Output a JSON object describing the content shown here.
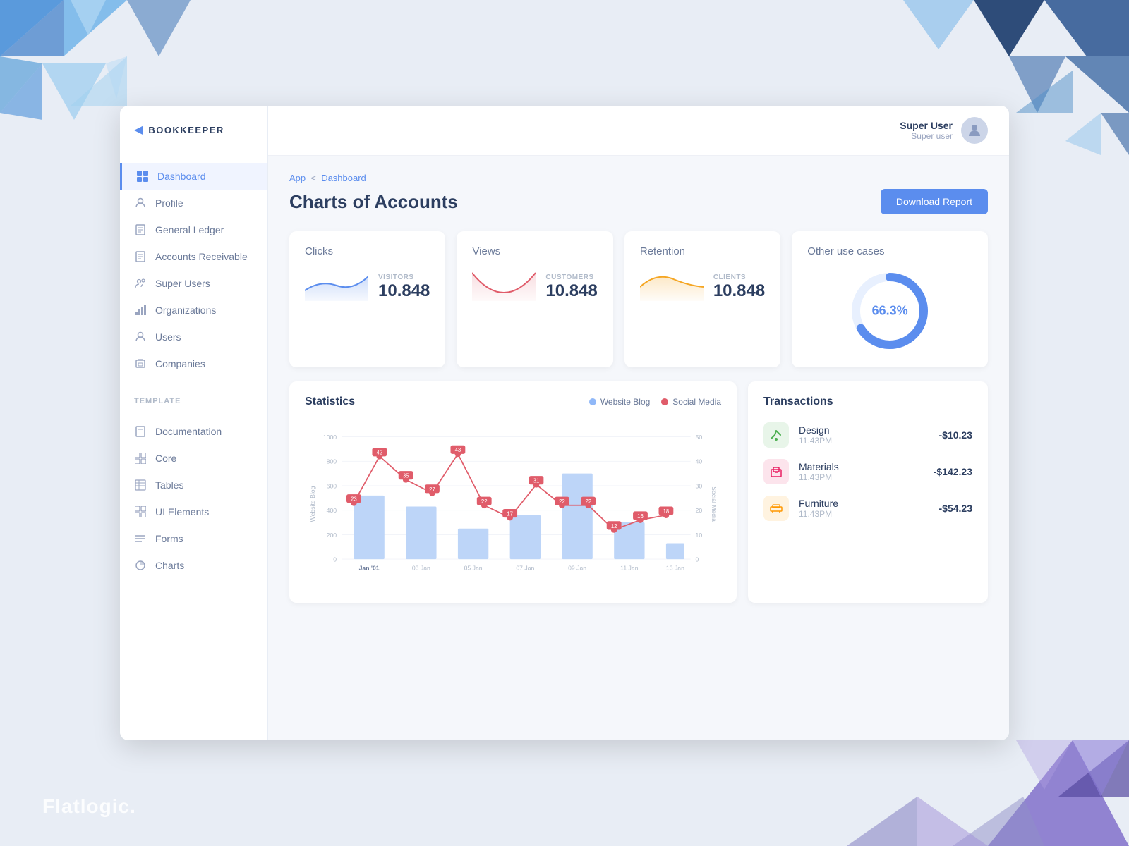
{
  "app": {
    "name": "BOOKKEEPER",
    "title": "Charts of Accounts",
    "breadcrumb": {
      "parent": "App",
      "separator": "<",
      "current": "Dashboard"
    }
  },
  "header": {
    "user": {
      "name": "Super User",
      "role": "Super user"
    },
    "download_button": "Download Report"
  },
  "sidebar": {
    "nav_items": [
      {
        "id": "dashboard",
        "label": "Dashboard",
        "active": true,
        "icon": "grid"
      },
      {
        "id": "profile",
        "label": "Profile",
        "active": false,
        "icon": "person"
      },
      {
        "id": "general-ledger",
        "label": "General Ledger",
        "active": false,
        "icon": "doc"
      },
      {
        "id": "accounts-receivable",
        "label": "Accounts Receivable",
        "active": false,
        "icon": "doc2"
      },
      {
        "id": "super-users",
        "label": "Super Users",
        "active": false,
        "icon": "people-star"
      },
      {
        "id": "organizations",
        "label": "Organizations",
        "active": false,
        "icon": "bar"
      },
      {
        "id": "users",
        "label": "Users",
        "active": false,
        "icon": "person2"
      },
      {
        "id": "companies",
        "label": "Companies",
        "active": false,
        "icon": "briefcase"
      }
    ],
    "template_label": "TEMPLATE",
    "template_items": [
      {
        "id": "documentation",
        "label": "Documentation",
        "icon": "doc3"
      },
      {
        "id": "core",
        "label": "Core",
        "icon": "grid2"
      },
      {
        "id": "tables",
        "label": "Tables",
        "icon": "grid3"
      },
      {
        "id": "ui-elements",
        "label": "UI Elements",
        "icon": "grid4"
      },
      {
        "id": "forms",
        "label": "Forms",
        "icon": "lines"
      },
      {
        "id": "charts",
        "label": "Charts",
        "icon": "pie"
      }
    ]
  },
  "stats": [
    {
      "id": "clicks",
      "label": "Clicks",
      "sublabel": "VISITORS",
      "value": "10.848",
      "color": "#5b8dee",
      "bg_color": "rgba(91,141,238,0.1)"
    },
    {
      "id": "views",
      "label": "Views",
      "sublabel": "CUSTOMERS",
      "value": "10.848",
      "color": "#e05c6a",
      "bg_color": "rgba(224,92,106,0.08)"
    },
    {
      "id": "retention",
      "label": "Retention",
      "sublabel": "CLIENTS",
      "value": "10.848",
      "color": "#f5a623",
      "bg_color": "rgba(245,166,35,0.1)"
    }
  ],
  "other_use_cases": {
    "title": "Other use cases",
    "percentage": "66.3%",
    "donut_value": 66.3,
    "color_main": "#5b8dee",
    "color_bg": "#e8f0fe"
  },
  "statistics": {
    "title": "Statistics",
    "legend": [
      {
        "label": "Website Blog",
        "color": "#90b8f8"
      },
      {
        "label": "Social Media",
        "color": "#e05c6a"
      }
    ],
    "x_labels": [
      "Jan '01",
      "03 Jan",
      "05 Jan",
      "07 Jan",
      "09 Jan",
      "11 Jan",
      "13 Jan"
    ],
    "bar_data": [
      520,
      430,
      250,
      360,
      700,
      300,
      130
    ],
    "line_data": [
      {
        "x": 0,
        "y": 23
      },
      {
        "x": 1,
        "y": 42
      },
      {
        "x": 2,
        "y": 35
      },
      {
        "x": 3,
        "y": 27
      },
      {
        "x": 4,
        "y": 43
      },
      {
        "x": 5,
        "y": 22
      },
      {
        "x": 6,
        "y": 17
      },
      {
        "x": 7,
        "y": 31
      },
      {
        "x": 8,
        "y": 22
      },
      {
        "x": 9,
        "y": 22
      },
      {
        "x": 10,
        "y": 12
      },
      {
        "x": 11,
        "y": 16
      },
      {
        "x": 12,
        "y": 18
      }
    ],
    "y_left_labels": [
      "0",
      "200",
      "400",
      "600",
      "800",
      "1000"
    ],
    "y_right_labels": [
      "0",
      "10",
      "20",
      "30",
      "40",
      "50"
    ]
  },
  "transactions": {
    "title": "Transactions",
    "items": [
      {
        "id": "design",
        "name": "Design",
        "time": "11.43PM",
        "amount": "-$10.23",
        "icon": "✂",
        "icon_bg": "#e8f5e9",
        "icon_color": "#4caf50"
      },
      {
        "id": "materials",
        "name": "Materials",
        "time": "11.43PM",
        "amount": "-$142.23",
        "icon": "📦",
        "icon_bg": "#fce4ec",
        "icon_color": "#e91e63"
      },
      {
        "id": "furniture",
        "name": "Furniture",
        "time": "11.43PM",
        "amount": "-$54.23",
        "icon": "🪑",
        "icon_bg": "#fff3e0",
        "icon_color": "#ff9800"
      }
    ]
  },
  "brand": "Flatlogic."
}
